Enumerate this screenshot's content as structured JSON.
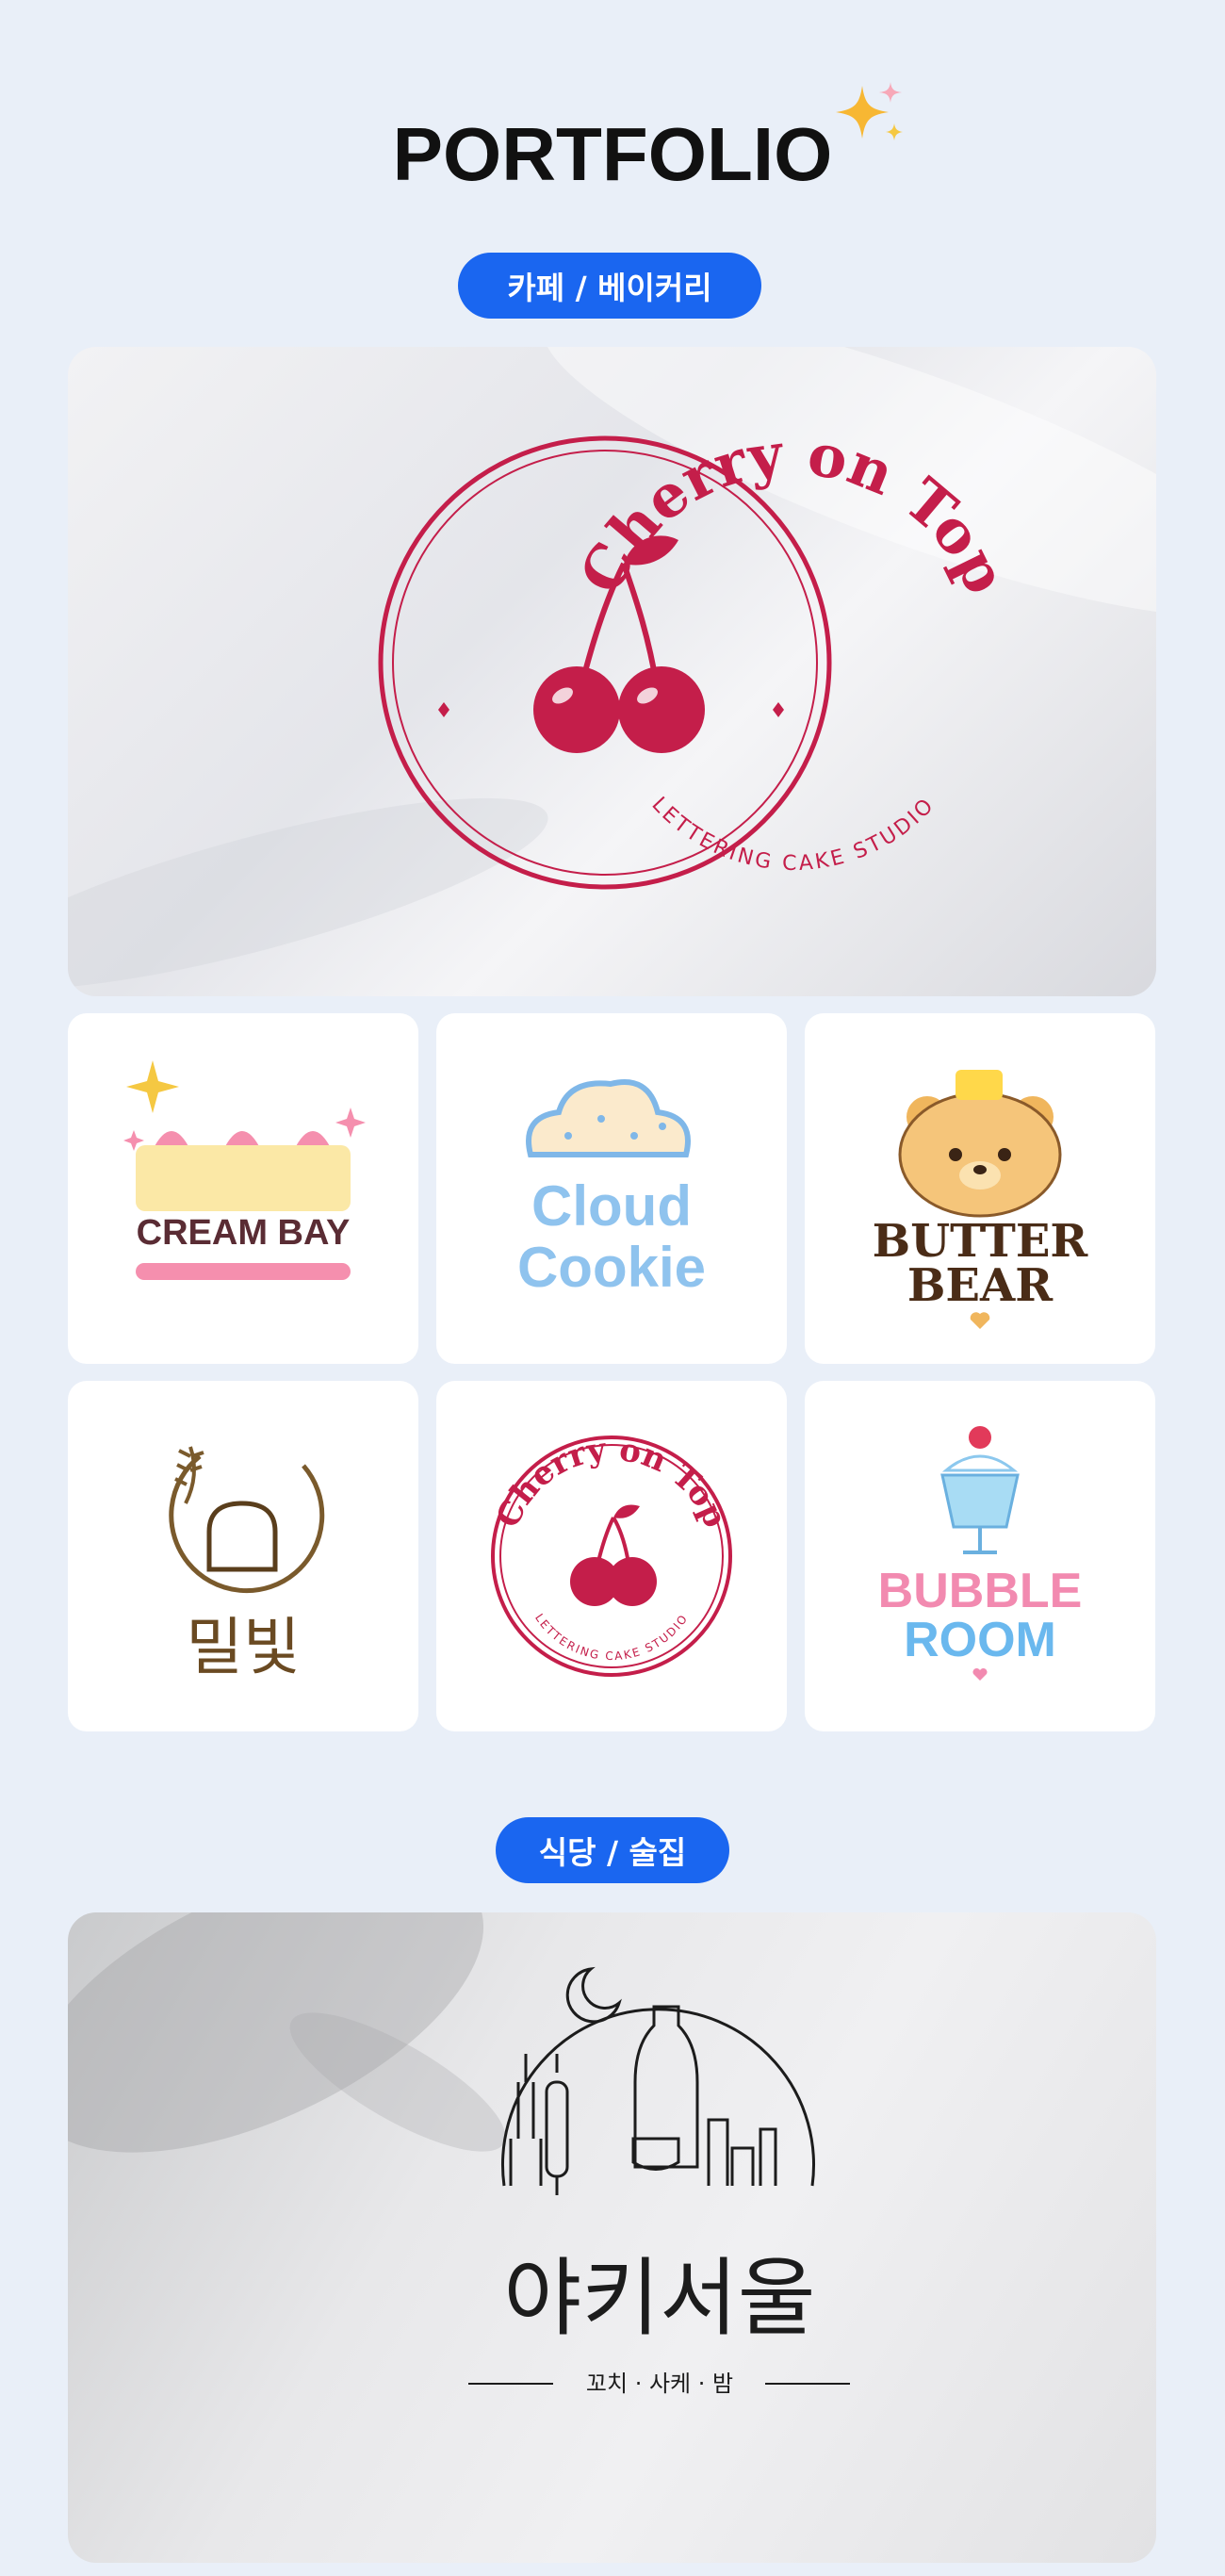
{
  "header": {
    "title": "PORTFOLIO"
  },
  "sections": [
    {
      "label": "카페 / 베이커리",
      "hero": {
        "brand": "Cherry on Top",
        "tagline": "LETTERING CAKE STUDIO"
      },
      "logos": [
        {
          "brand": "CREAM BAY"
        },
        {
          "brand_line1": "Cloud",
          "brand_line2": "Cookie"
        },
        {
          "brand_line1": "BUTTER",
          "brand_line2": "BEAR"
        },
        {
          "brand": "밀빛"
        },
        {
          "brand": "Cherry on Top",
          "tagline": "LETTERING CAKE STUDIO"
        },
        {
          "brand_line1": "BUBBLE",
          "brand_line2": "ROOM"
        }
      ]
    },
    {
      "label": "식당 / 술집",
      "hero": {
        "brand": "야키서울",
        "tagline": "꼬치 · 사케 · 밤"
      }
    }
  ],
  "colors": {
    "accent": "#1a66f0",
    "cherry": "#c41e4a",
    "background": "#e9eff8"
  }
}
